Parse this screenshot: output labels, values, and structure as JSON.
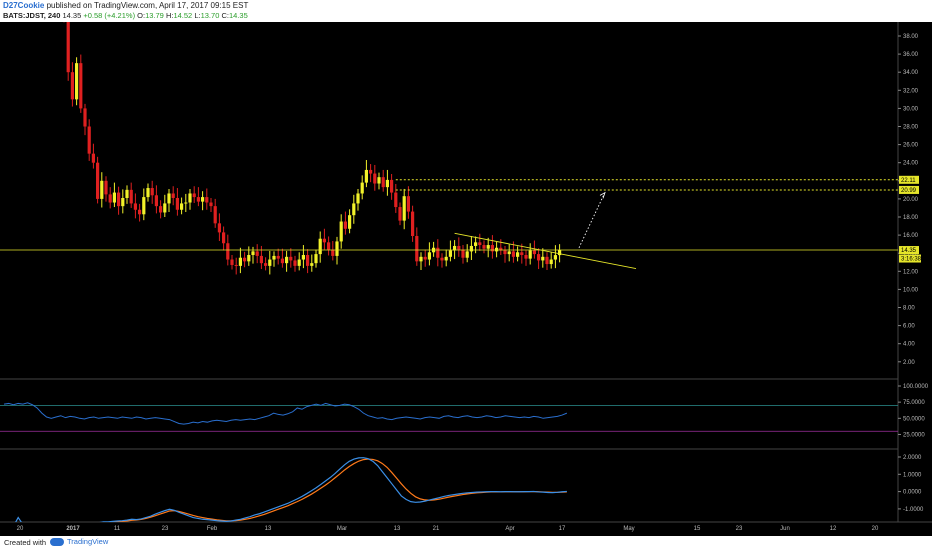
{
  "header": {
    "author": "D27Cookie",
    "published": " published on TradingView.com, April 17, 2017 09:15 EST",
    "symbol": "BATS:JDST, 240",
    "last": "14.35",
    "change": "+0.58 (+4.21%)",
    "open_label": "O:",
    "open": "13.79",
    "high_label": "H:",
    "high": "14.52",
    "low_label": "L:",
    "low": "13.70",
    "close_label": "C:",
    "close": "14.35"
  },
  "footer": {
    "created_with": "Created with",
    "brand": "TradingView"
  },
  "colors": {
    "up_candle": "#f2f22a",
    "down_candle": "#e02020",
    "background": "#000000",
    "rsi_line": "#2a6fcf",
    "macd_line": "#3b8fe6",
    "signal_line": "#ff7a1a",
    "level_line": "#e6e62a"
  },
  "chart_data": [
    {
      "type": "candlestick",
      "price_axis_ticks": [
        "38.00",
        "36.00",
        "34.00",
        "32.00",
        "30.00",
        "28.00",
        "26.00",
        "24.00",
        "22.00",
        "20.00",
        "18.00",
        "16.00",
        "14.00",
        "12.00",
        "10.00",
        "8.00",
        "6.00",
        "4.00",
        "2.00"
      ],
      "time_axis_ticks": [
        "20",
        "2017",
        "11",
        "23",
        "Feb",
        "13",
        "Mar",
        "13",
        "21",
        "Apr",
        "17",
        "May",
        "15",
        "23",
        "Jun",
        "12",
        "20"
      ],
      "ylim": [
        0,
        40
      ],
      "closes": [
        40,
        34,
        31,
        35,
        30,
        28,
        25,
        24,
        20,
        22,
        20.5,
        19.6,
        20.7,
        19.2,
        20.1,
        21,
        19.5,
        18.8,
        18.3,
        20.2,
        21.2,
        20.4,
        19.2,
        18.5,
        19.5,
        20.6,
        20.1,
        18.8,
        19.5,
        19.6,
        20.6,
        20.2,
        19.7,
        20.2,
        19.6,
        19.2,
        17.3,
        16.3,
        15.1,
        13.3,
        12.7,
        12.6,
        13.5,
        13.1,
        13.8,
        14.2,
        13.7,
        12.9,
        12.6,
        13.3,
        13.7,
        13.4,
        12.9,
        13.6,
        13.2,
        12.6,
        13.3,
        13.8,
        12.6,
        12.9,
        13.9,
        15.6,
        15.2,
        14.4,
        13.7,
        15.3,
        17.5,
        16.7,
        18.2,
        19.5,
        20.6,
        21.8,
        23.2,
        22.8,
        21.7,
        22.4,
        21.3,
        22.1,
        20.7,
        19.1,
        17.6,
        20.3,
        18.6,
        15.9,
        13.1,
        13.6,
        13.3,
        14.1,
        14.6,
        13.5,
        13.2,
        13.6,
        14.3,
        14.8,
        14.4,
        13.5,
        14.2,
        14.8,
        15.2,
        14.9,
        14.5,
        14.9,
        14.2,
        14.6,
        14.3,
        13.9,
        14.2,
        13.6,
        14.1,
        13.8,
        13.4,
        14.3,
        13.9,
        13.2,
        13.6,
        12.8,
        13.3,
        13.79,
        14.35
      ],
      "horizontal_levels": [
        {
          "label": "22.11",
          "value": 22.11,
          "style": "dotted"
        },
        {
          "label": "20.99",
          "value": 20.99,
          "style": "dotted"
        },
        {
          "label": "14.35",
          "value": 14.35,
          "style": "solid"
        }
      ],
      "countdown_label": "3:16:38",
      "trendline": {
        "from": [
          13.2,
          16.2
        ],
        "to": [
          0,
          12.3
        ]
      },
      "projection": {
        "from_value": 14.35,
        "to_value": 20.6
      }
    },
    {
      "type": "line",
      "indicator": "RSI",
      "ticks": [
        "100.0000",
        "75.0000",
        "50.0000",
        "25.0000"
      ],
      "ylim": [
        0,
        100
      ],
      "levels": [
        70,
        30
      ],
      "values": [
        72,
        73,
        71,
        73,
        72,
        74,
        71,
        66,
        58,
        52,
        50,
        52,
        54,
        51,
        53,
        52,
        50,
        49,
        51,
        52,
        50,
        51,
        52,
        51,
        50,
        52,
        51,
        50,
        52,
        51,
        49,
        50,
        51,
        50,
        49,
        48,
        45,
        42,
        41,
        42,
        44,
        43,
        45,
        44,
        46,
        47,
        46,
        45,
        47,
        48,
        47,
        48,
        49,
        48,
        50,
        52,
        54,
        58,
        56,
        55,
        57,
        60,
        66,
        64,
        68,
        70,
        72,
        70,
        73,
        71,
        69,
        70,
        72,
        71,
        68,
        64,
        58,
        54,
        52,
        50,
        51,
        49,
        48,
        50,
        51,
        52,
        51,
        50,
        49,
        51,
        52,
        51,
        50,
        53,
        54,
        52,
        51,
        53,
        54,
        52,
        51,
        52,
        54,
        53,
        51,
        52,
        54,
        53,
        52,
        51,
        52,
        51,
        53,
        52,
        50,
        51,
        52,
        53,
        55,
        58
      ]
    },
    {
      "type": "line",
      "indicator": "MACD",
      "ticks": [
        "2.0000",
        "1.0000",
        "0.0000",
        "-1.0000"
      ],
      "ylim": [
        -1.5,
        2.2
      ],
      "series": [
        {
          "values": [
            -3,
            -2.5,
            -2,
            -1.5,
            -1.9,
            -2.4,
            -3.2,
            -3.8,
            -3.6,
            -3.2,
            -2.9,
            -2.6,
            -2.4,
            -2.1,
            -2,
            -1.9,
            -1.85,
            -1.8,
            -1.82,
            -1.85,
            -1.8,
            -1.75,
            -1.75,
            -1.72,
            -1.7,
            -1.68,
            -1.65,
            -1.6,
            -1.62,
            -1.58,
            -1.5,
            -1.42,
            -1.3,
            -1.2,
            -1.1,
            -1.02,
            -1.08,
            -1.2,
            -1.3,
            -1.4,
            -1.5,
            -1.55,
            -1.6,
            -1.62,
            -1.65,
            -1.68,
            -1.7,
            -1.72,
            -1.7,
            -1.65,
            -1.6,
            -1.52,
            -1.45,
            -1.35,
            -1.28,
            -1.18,
            -1.08,
            -0.98,
            -0.88,
            -0.78,
            -0.68,
            -0.55,
            -0.42,
            -0.28,
            -0.12,
            0.05,
            0.22,
            0.42,
            0.62,
            0.82,
            1.05,
            1.3,
            1.55,
            1.75,
            1.88,
            1.95,
            1.96,
            1.9,
            1.75,
            1.5,
            1.15,
            0.8,
            0.45,
            0.1,
            -0.25,
            -0.45,
            -0.58,
            -0.62,
            -0.6,
            -0.55,
            -0.48,
            -0.42,
            -0.35,
            -0.28,
            -0.22,
            -0.18,
            -0.14,
            -0.1,
            -0.07,
            -0.05,
            -0.03,
            -0.02,
            -0.01,
            0,
            0,
            -0.01,
            0,
            0,
            -0.01,
            -0.01,
            0,
            0,
            0.01,
            -0.02,
            -0.03,
            -0.05,
            -0.06,
            -0.04,
            -0.01,
            0.01
          ]
        },
        {
          "values": [
            -3.6,
            -3.4,
            -3.2,
            -3,
            -3.1,
            -3.3,
            -3.5,
            -3.8,
            -3.9,
            -3.7,
            -3.4,
            -3.1,
            -2.8,
            -2.5,
            -2.3,
            -2.1,
            -2,
            -1.9,
            -1.85,
            -1.85,
            -1.83,
            -1.8,
            -1.78,
            -1.76,
            -1.74,
            -1.72,
            -1.7,
            -1.66,
            -1.64,
            -1.61,
            -1.55,
            -1.48,
            -1.39,
            -1.3,
            -1.21,
            -1.12,
            -1.1,
            -1.15,
            -1.22,
            -1.3,
            -1.38,
            -1.45,
            -1.5,
            -1.55,
            -1.59,
            -1.63,
            -1.66,
            -1.69,
            -1.69,
            -1.68,
            -1.65,
            -1.6,
            -1.55,
            -1.48,
            -1.4,
            -1.32,
            -1.22,
            -1.12,
            -1.02,
            -0.92,
            -0.82,
            -0.7,
            -0.58,
            -0.45,
            -0.3,
            -0.15,
            0.02,
            0.2,
            0.38,
            0.58,
            0.8,
            1.02,
            1.25,
            1.45,
            1.62,
            1.76,
            1.85,
            1.88,
            1.86,
            1.78,
            1.62,
            1.4,
            1.1,
            0.78,
            0.45,
            0.15,
            -0.1,
            -0.3,
            -0.42,
            -0.48,
            -0.5,
            -0.48,
            -0.44,
            -0.38,
            -0.32,
            -0.27,
            -0.22,
            -0.17,
            -0.13,
            -0.1,
            -0.07,
            -0.05,
            -0.03,
            -0.02,
            -0.02,
            -0.02,
            -0.01,
            -0.01,
            -0.01,
            -0.01,
            -0.01,
            0,
            0,
            -0.01,
            -0.02,
            -0.03,
            -0.04,
            -0.04,
            -0.03,
            -0.02
          ]
        }
      ]
    }
  ]
}
